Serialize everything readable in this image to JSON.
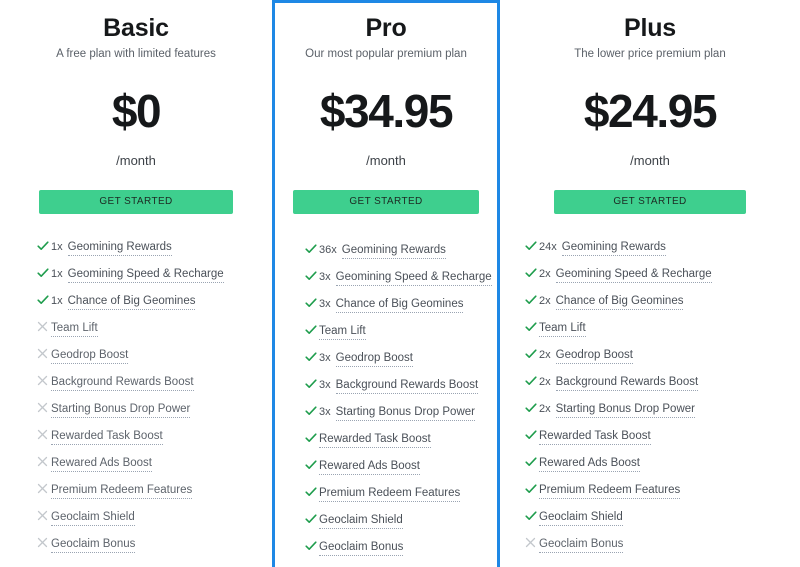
{
  "accent": {
    "highlight_border": "#1e88e5",
    "cta_green": "#3ecf8e",
    "check_green": "#1f9d4d",
    "cross_gray": "#c3c7cc"
  },
  "cta_label": "GET STARTED",
  "period_label": "/month",
  "icons": {
    "check": "check-icon",
    "cross": "cross-icon"
  },
  "plans": [
    {
      "id": "basic",
      "name": "Basic",
      "tagline": "A free plan with limited features",
      "price": "$0",
      "period": "/month",
      "cta": "GET STARTED",
      "highlighted": false,
      "features": [
        {
          "included": true,
          "qty": "1x",
          "label": "Geomining Rewards"
        },
        {
          "included": true,
          "qty": "1x",
          "label": "Geomining Speed & Recharge"
        },
        {
          "included": true,
          "qty": "1x",
          "label": "Chance of Big Geomines"
        },
        {
          "included": false,
          "qty": "",
          "label": "Team Lift"
        },
        {
          "included": false,
          "qty": "",
          "label": "Geodrop Boost"
        },
        {
          "included": false,
          "qty": "",
          "label": "Background Rewards Boost"
        },
        {
          "included": false,
          "qty": "",
          "label": "Starting Bonus Drop Power"
        },
        {
          "included": false,
          "qty": "",
          "label": "Rewarded Task Boost"
        },
        {
          "included": false,
          "qty": "",
          "label": "Rewared Ads Boost"
        },
        {
          "included": false,
          "qty": "",
          "label": "Premium Redeem Features"
        },
        {
          "included": false,
          "qty": "",
          "label": "Geoclaim Shield"
        },
        {
          "included": false,
          "qty": "",
          "label": "Geoclaim Bonus"
        }
      ]
    },
    {
      "id": "pro",
      "name": "Pro",
      "tagline": "Our most popular premium plan",
      "price": "$34.95",
      "period": "/month",
      "cta": "GET STARTED",
      "highlighted": true,
      "features": [
        {
          "included": true,
          "qty": "36x",
          "label": "Geomining Rewards"
        },
        {
          "included": true,
          "qty": "3x",
          "label": "Geomining Speed & Recharge"
        },
        {
          "included": true,
          "qty": "3x",
          "label": "Chance of Big Geomines"
        },
        {
          "included": true,
          "qty": "",
          "label": "Team Lift"
        },
        {
          "included": true,
          "qty": "3x",
          "label": "Geodrop Boost"
        },
        {
          "included": true,
          "qty": "3x",
          "label": "Background Rewards Boost"
        },
        {
          "included": true,
          "qty": "3x",
          "label": "Starting Bonus Drop Power"
        },
        {
          "included": true,
          "qty": "",
          "label": "Rewarded Task Boost"
        },
        {
          "included": true,
          "qty": "",
          "label": "Rewared Ads Boost"
        },
        {
          "included": true,
          "qty": "",
          "label": "Premium Redeem Features"
        },
        {
          "included": true,
          "qty": "",
          "label": "Geoclaim Shield"
        },
        {
          "included": true,
          "qty": "",
          "label": "Geoclaim Bonus"
        }
      ]
    },
    {
      "id": "plus",
      "name": "Plus",
      "tagline": "The lower price premium plan",
      "price": "$24.95",
      "period": "/month",
      "cta": "GET STARTED",
      "highlighted": false,
      "features": [
        {
          "included": true,
          "qty": "24x",
          "label": "Geomining Rewards"
        },
        {
          "included": true,
          "qty": "2x",
          "label": "Geomining Speed & Recharge"
        },
        {
          "included": true,
          "qty": "2x",
          "label": "Chance of Big Geomines"
        },
        {
          "included": true,
          "qty": "",
          "label": "Team Lift"
        },
        {
          "included": true,
          "qty": "2x",
          "label": "Geodrop Boost"
        },
        {
          "included": true,
          "qty": "2x",
          "label": "Background Rewards Boost"
        },
        {
          "included": true,
          "qty": "2x",
          "label": "Starting Bonus Drop Power"
        },
        {
          "included": true,
          "qty": "",
          "label": "Rewarded Task Boost"
        },
        {
          "included": true,
          "qty": "",
          "label": "Rewared Ads Boost"
        },
        {
          "included": true,
          "qty": "",
          "label": "Premium Redeem Features"
        },
        {
          "included": true,
          "qty": "",
          "label": "Geoclaim Shield"
        },
        {
          "included": false,
          "qty": "",
          "label": "Geoclaim Bonus"
        }
      ]
    }
  ]
}
